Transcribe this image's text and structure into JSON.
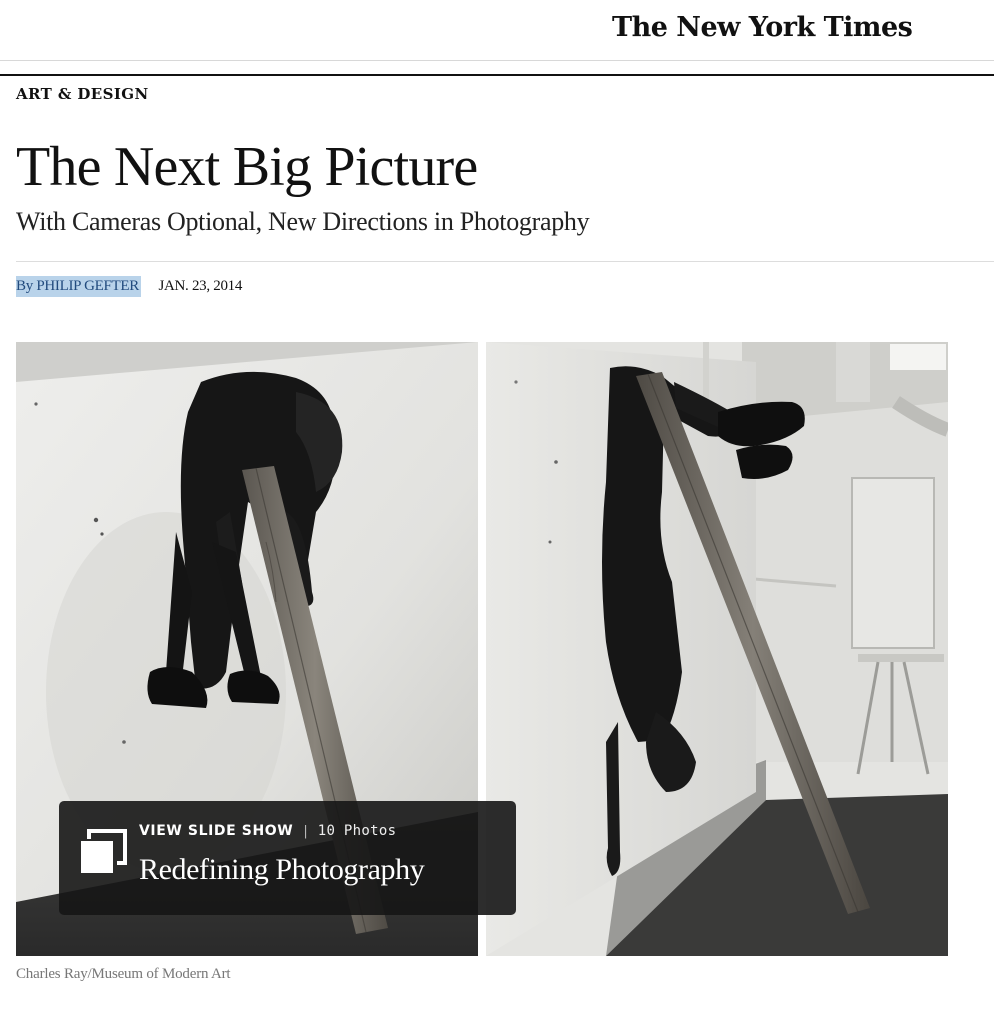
{
  "masthead": {
    "logo": "The New York Times"
  },
  "article": {
    "section": "ART & DESIGN",
    "headline": "The Next Big Picture",
    "summary": "With Cameras Optional, New Directions in Photography",
    "byline": {
      "prefix": "By",
      "author": "PHILIP GEFTER",
      "date": "JAN. 23, 2014"
    }
  },
  "media": {
    "left_image": "black and white photograph, figure draped over a wooden plank leaning on a wall",
    "right_image": "black and white photograph, figure hanging upside down behind a leaning plank",
    "slideshow": {
      "icon": "slideshow-icon",
      "cta": "VIEW SLIDE SHOW",
      "separator": "|",
      "count": "10 Photos",
      "title": "Redefining Photography"
    },
    "credit": "Charles Ray/Museum of Modern Art"
  },
  "colors": {
    "byline_highlight": "#b9d3ea",
    "link": "#224b7e",
    "rule": "#111111",
    "overlay": "#161616"
  }
}
